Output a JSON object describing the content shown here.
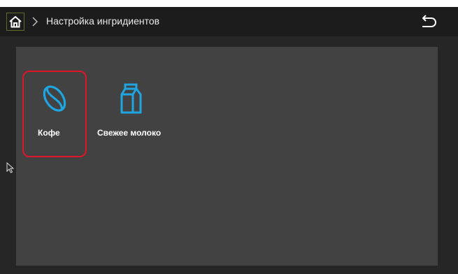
{
  "header": {
    "title": "Настройка ингридиентов"
  },
  "icons": {
    "home": "home-icon",
    "breadcrumb_separator": "chevron-right-icon",
    "back": "back-arrow-icon",
    "coffee": "coffee-bean-icon",
    "milk": "milk-carton-icon"
  },
  "ingredients": [
    {
      "label": "Кофе",
      "selected": true
    },
    {
      "label": "Свежее молоко",
      "selected": false
    }
  ],
  "colors": {
    "accent_icon": "#1fa6e0",
    "selection_border": "#e0152a",
    "topbar_bg": "#1c1c1c",
    "panel_bg": "#424242",
    "screen_bg": "#262626"
  }
}
